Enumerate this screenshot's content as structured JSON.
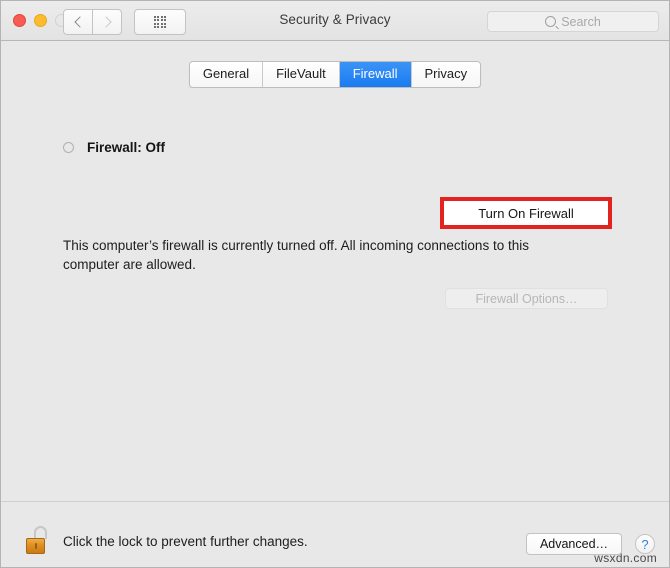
{
  "window": {
    "title": "Security & Privacy",
    "traffic_lights": [
      "close",
      "minimize",
      "zoom"
    ]
  },
  "toolbar": {
    "back_icon": "chevron-left-icon",
    "forward_icon": "chevron-right-icon",
    "show_all_icon": "grid-dots-icon",
    "search": {
      "placeholder": "Search",
      "value": "",
      "icon": "search-icon"
    }
  },
  "tabs": [
    {
      "label": "General",
      "active": false
    },
    {
      "label": "FileVault",
      "active": false
    },
    {
      "label": "Firewall",
      "active": true
    },
    {
      "label": "Privacy",
      "active": false
    }
  ],
  "firewall_pane": {
    "status_label": "Firewall: Off",
    "status_indicator": "status-dot-off",
    "turn_on_button": "Turn On Firewall",
    "description": "This computer’s firewall is currently turned off. All incoming connections to this computer are allowed.",
    "options_button": "Firewall Options…",
    "options_button_disabled": true,
    "highlight_color": "#e2231f",
    "accent_color": "#1a7cf0"
  },
  "bottom_bar": {
    "lock_icon": "padlock-open-icon",
    "lock_text": "Click the lock to prevent further changes.",
    "advanced_button": "Advanced…",
    "help_button": "?"
  },
  "watermark": "wsxdn.com"
}
